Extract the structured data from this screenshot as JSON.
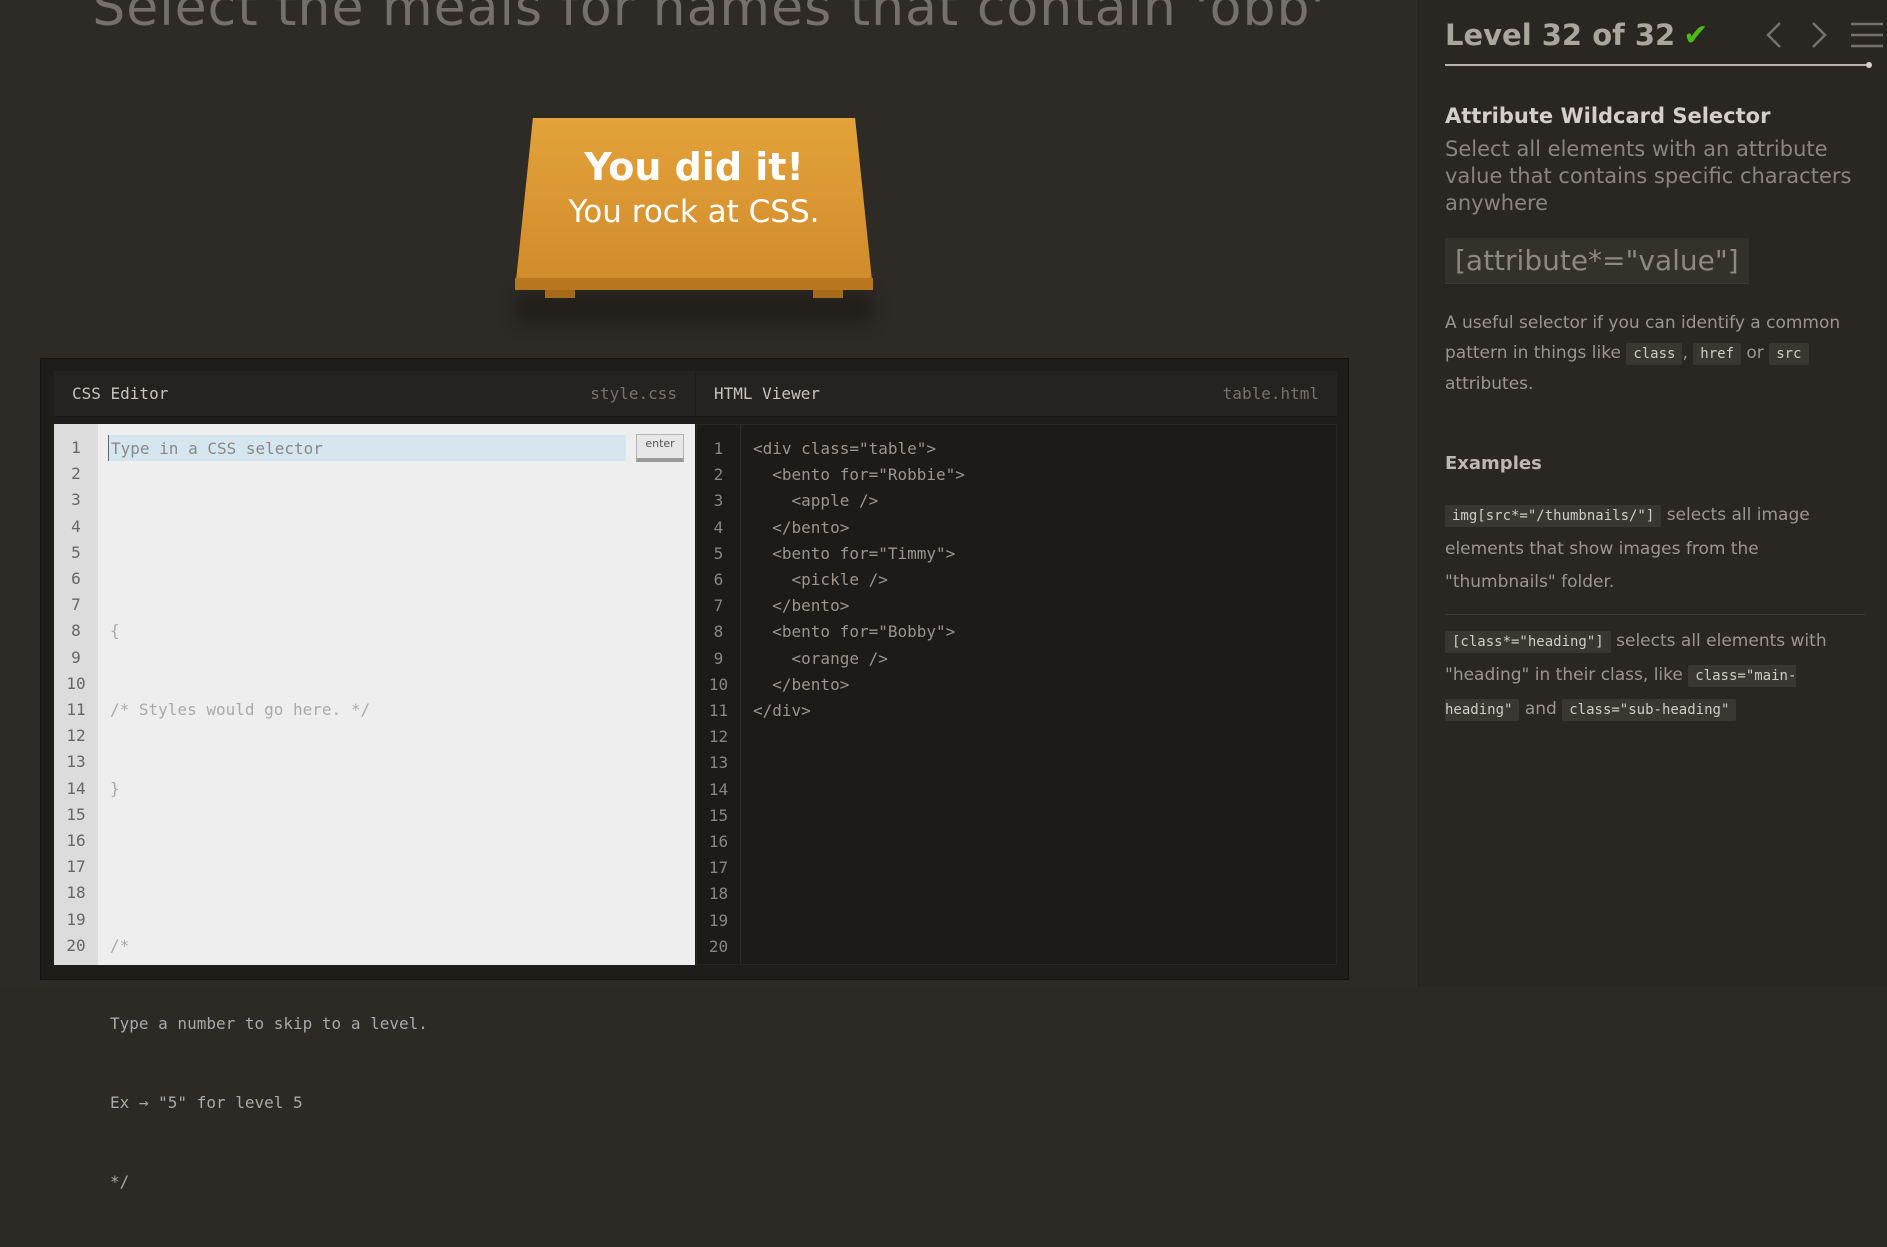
{
  "game": {
    "instruction": "Select the meals for names that contain 'obb'",
    "table_message_line1": "You did it!",
    "table_message_line2": "You rock at CSS."
  },
  "css_editor": {
    "title": "CSS Editor",
    "filename": "style.css",
    "input_placeholder": "Type in a CSS selector",
    "enter_label": "enter",
    "code_lines": [
      "{",
      "/* Styles would go here. */",
      "}",
      "",
      "/*",
      "Type a number to skip to a level.",
      "Ex → \"5\" for level 5",
      "*/"
    ],
    "line_numbers": "1\n2\n3\n4\n5\n6\n7\n8\n9\n10\n11\n12\n13\n14\n15\n16\n17\n18\n19\n20"
  },
  "html_viewer": {
    "title": "HTML Viewer",
    "filename": "table.html",
    "code": "<div class=\"table\">\n  <bento for=\"Robbie\">\n    <apple />\n  </bento>\n  <bento for=\"Timmy\">\n    <pickle />\n  </bento>\n  <bento for=\"Bobby\">\n    <orange />\n  </bento>\n</div>",
    "line_numbers": "1\n2\n3\n4\n5\n6\n7\n8\n9\n10\n11\n12\n13\n14\n15\n16\n17\n18\n19\n20"
  },
  "sidebar": {
    "level_text": "Level 32 of 32",
    "check_mark": "✔",
    "progress_fraction": 1.0,
    "selector_name": "Attribute Wildcard Selector",
    "selector_title": "Select all elements with an attribute value that contains specific characters anywhere",
    "syntax": "[attribute*=\"value\"]",
    "hint_text_1": "A useful selector if you can identify a common pattern in things like",
    "hint_code_1": "class",
    "hint_sep": ",",
    "hint_code_2": "href",
    "hint_or": "or",
    "hint_code_3": "src",
    "hint_text_2": "attributes.",
    "examples_heading": "Examples",
    "example1_code": "img[src*=\"/thumbnails/\"]",
    "example1_text": "selects all image elements that show images from the \"thumbnails\" folder.",
    "example2_code": "[class*=\"heading\"]",
    "example2_text": "selects all elements with \"heading\" in their class, like",
    "example2_code2": "class=\"main-heading\"",
    "example2_and": "and",
    "example2_code3": "class=\"sub-heading\""
  },
  "icons": [
    "chevron-left-icon",
    "chevron-right-icon",
    "menu-icon",
    "check-icon"
  ],
  "colors": {
    "table": "#e4a23a",
    "check": "#4cbb17",
    "background": "#2e2a25"
  }
}
